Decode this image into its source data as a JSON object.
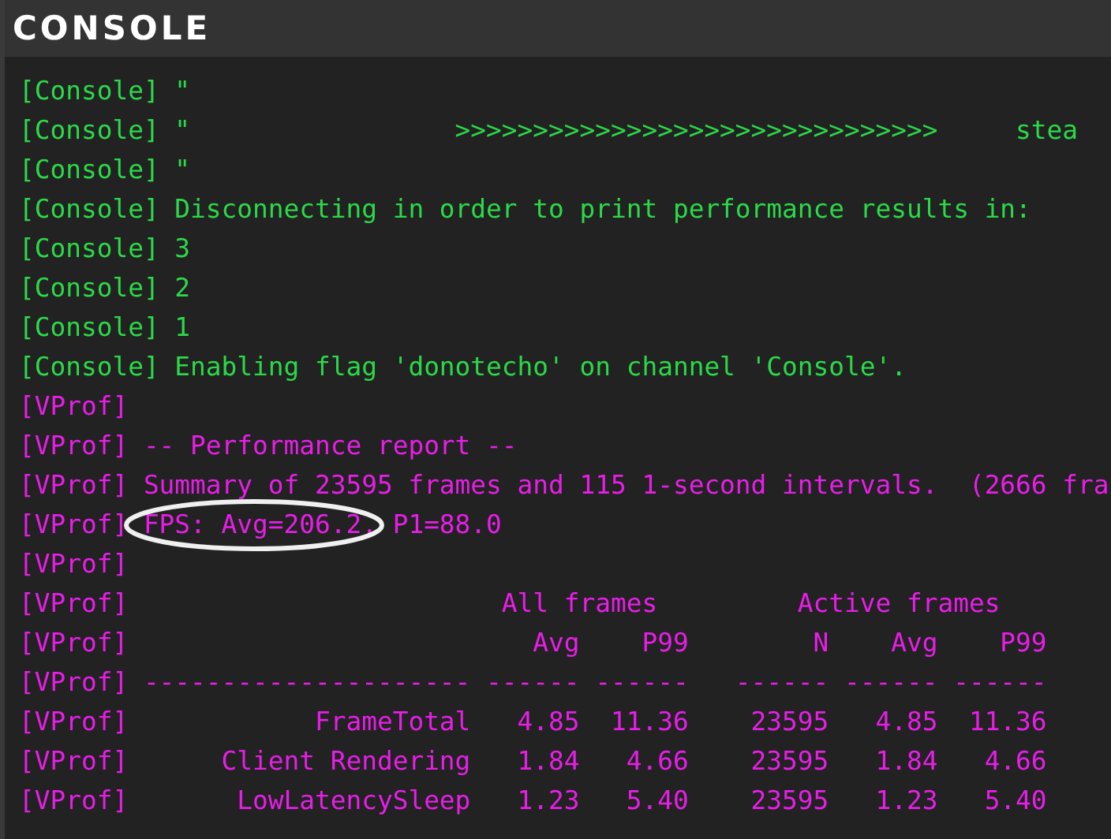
{
  "header": {
    "title": "CONSOLE"
  },
  "lines": [
    {
      "kind": "console",
      "text": "[Console] \"",
      "circled": false
    },
    {
      "kind": "console",
      "text": "[Console] \"                 >>>>>>>>>>>>>>>>>>>>>>>>>>>>>>>     stea",
      "circled": false
    },
    {
      "kind": "console",
      "text": "[Console] \"",
      "circled": false
    },
    {
      "kind": "console",
      "text": "[Console] Disconnecting in order to print performance results in:",
      "circled": false
    },
    {
      "kind": "console",
      "text": "[Console] 3",
      "circled": false
    },
    {
      "kind": "console",
      "text": "[Console] 2",
      "circled": false
    },
    {
      "kind": "console",
      "text": "[Console] 1",
      "circled": false
    },
    {
      "kind": "console",
      "text": "[Console] Enabling flag 'donotecho' on channel 'Console'.",
      "circled": false
    },
    {
      "kind": "vprof",
      "text": "[VProf]",
      "circled": false
    },
    {
      "kind": "vprof",
      "text": "[VProf] -- Performance report --",
      "circled": false
    },
    {
      "kind": "vprof",
      "text": "[VProf] Summary of 23595 frames and 115 1-second intervals.  (2666 fra",
      "circled": false
    },
    {
      "kind": "vprof",
      "text": "[VProf] FPS: Avg=206.2, P1=88.0",
      "circled": true
    },
    {
      "kind": "vprof",
      "text": "[VProf]",
      "circled": false
    },
    {
      "kind": "vprof",
      "text": "[VProf]                        All frames         Active frames",
      "circled": false
    },
    {
      "kind": "vprof",
      "text": "[VProf]                          Avg    P99        N    Avg    P99",
      "circled": false
    },
    {
      "kind": "vprof",
      "text": "[VProf] --------------------- ------ ------   ------ ------ ------",
      "circled": false
    },
    {
      "kind": "vprof",
      "text": "[VProf]            FrameTotal   4.85  11.36    23595   4.85  11.36",
      "circled": false
    },
    {
      "kind": "vprof",
      "text": "[VProf]      Client Rendering   1.84   4.66    23595   1.84   4.66",
      "circled": false
    },
    {
      "kind": "vprof",
      "text": "[VProf]       LowLatencySleep   1.23   5.40    23595   1.23   5.40",
      "circled": false
    }
  ]
}
